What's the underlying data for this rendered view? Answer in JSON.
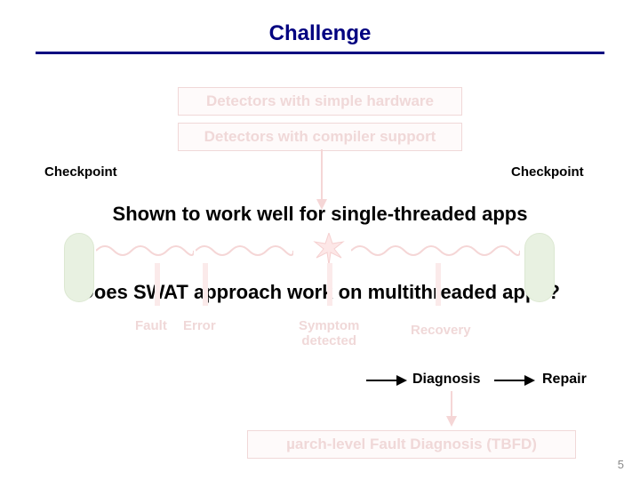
{
  "title": "Challenge",
  "boxes": {
    "hardware": "Detectors with simple hardware",
    "compiler": "Detectors with compiler support",
    "diagnosis_box": "µarch-level Fault Diagnosis (TBFD)"
  },
  "checkpoint_left": "Checkpoint",
  "checkpoint_right": "Checkpoint",
  "statement1": "Shown to work well for single-threaded apps",
  "statement2": "Does SWAT approach work on multithreaded apps?",
  "labels": {
    "fault": "Fault",
    "error": "Error",
    "symptom": "Symptom\ndetected",
    "recovery": "Recovery"
  },
  "flow": {
    "diagnosis": "Diagnosis",
    "repair": "Repair"
  },
  "slide_number": "5"
}
